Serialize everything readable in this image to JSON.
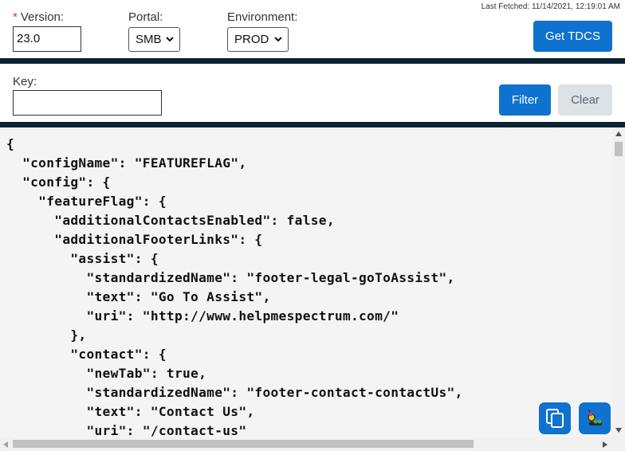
{
  "header": {
    "last_fetched": "Last Fetched: 11/14/2021, 12:19:01 AM",
    "version_label": "Version:",
    "version_required_marker": "*",
    "version_value": "23.0",
    "portal_label": "Portal:",
    "portal_selected": "SMB",
    "environment_label": "Environment:",
    "environment_selected": "PROD",
    "get_button": "Get TDCS"
  },
  "filter": {
    "key_label": "Key:",
    "key_value": "",
    "filter_button": "Filter",
    "clear_button": "Clear"
  },
  "code": {
    "text": "{\n  \"configName\": \"FEATUREFLAG\",\n  \"config\": {\n    \"featureFlag\": {\n      \"additionalContactsEnabled\": false,\n      \"additionalFooterLinks\": {\n        \"assist\": {\n          \"standardizedName\": \"footer-legal-goToAssist\",\n          \"text\": \"Go To Assist\",\n          \"uri\": \"http://www.helpmespectrum.com/\"\n        },\n        \"contact\": {\n          \"newTab\": true,\n          \"standardizedName\": \"footer-contact-contactUs\",\n          \"text\": \"Contact Us\",\n          \"uri\": \"/contact-us\""
  },
  "icons": {
    "chevron": "chevron-down-icon",
    "copy": "copy-icon",
    "bug": "bug-icon"
  },
  "colors": {
    "primary": "#0f72cf",
    "divider": "#0c2432",
    "required": "#d9342b",
    "code_background": "#f4f4f4"
  }
}
